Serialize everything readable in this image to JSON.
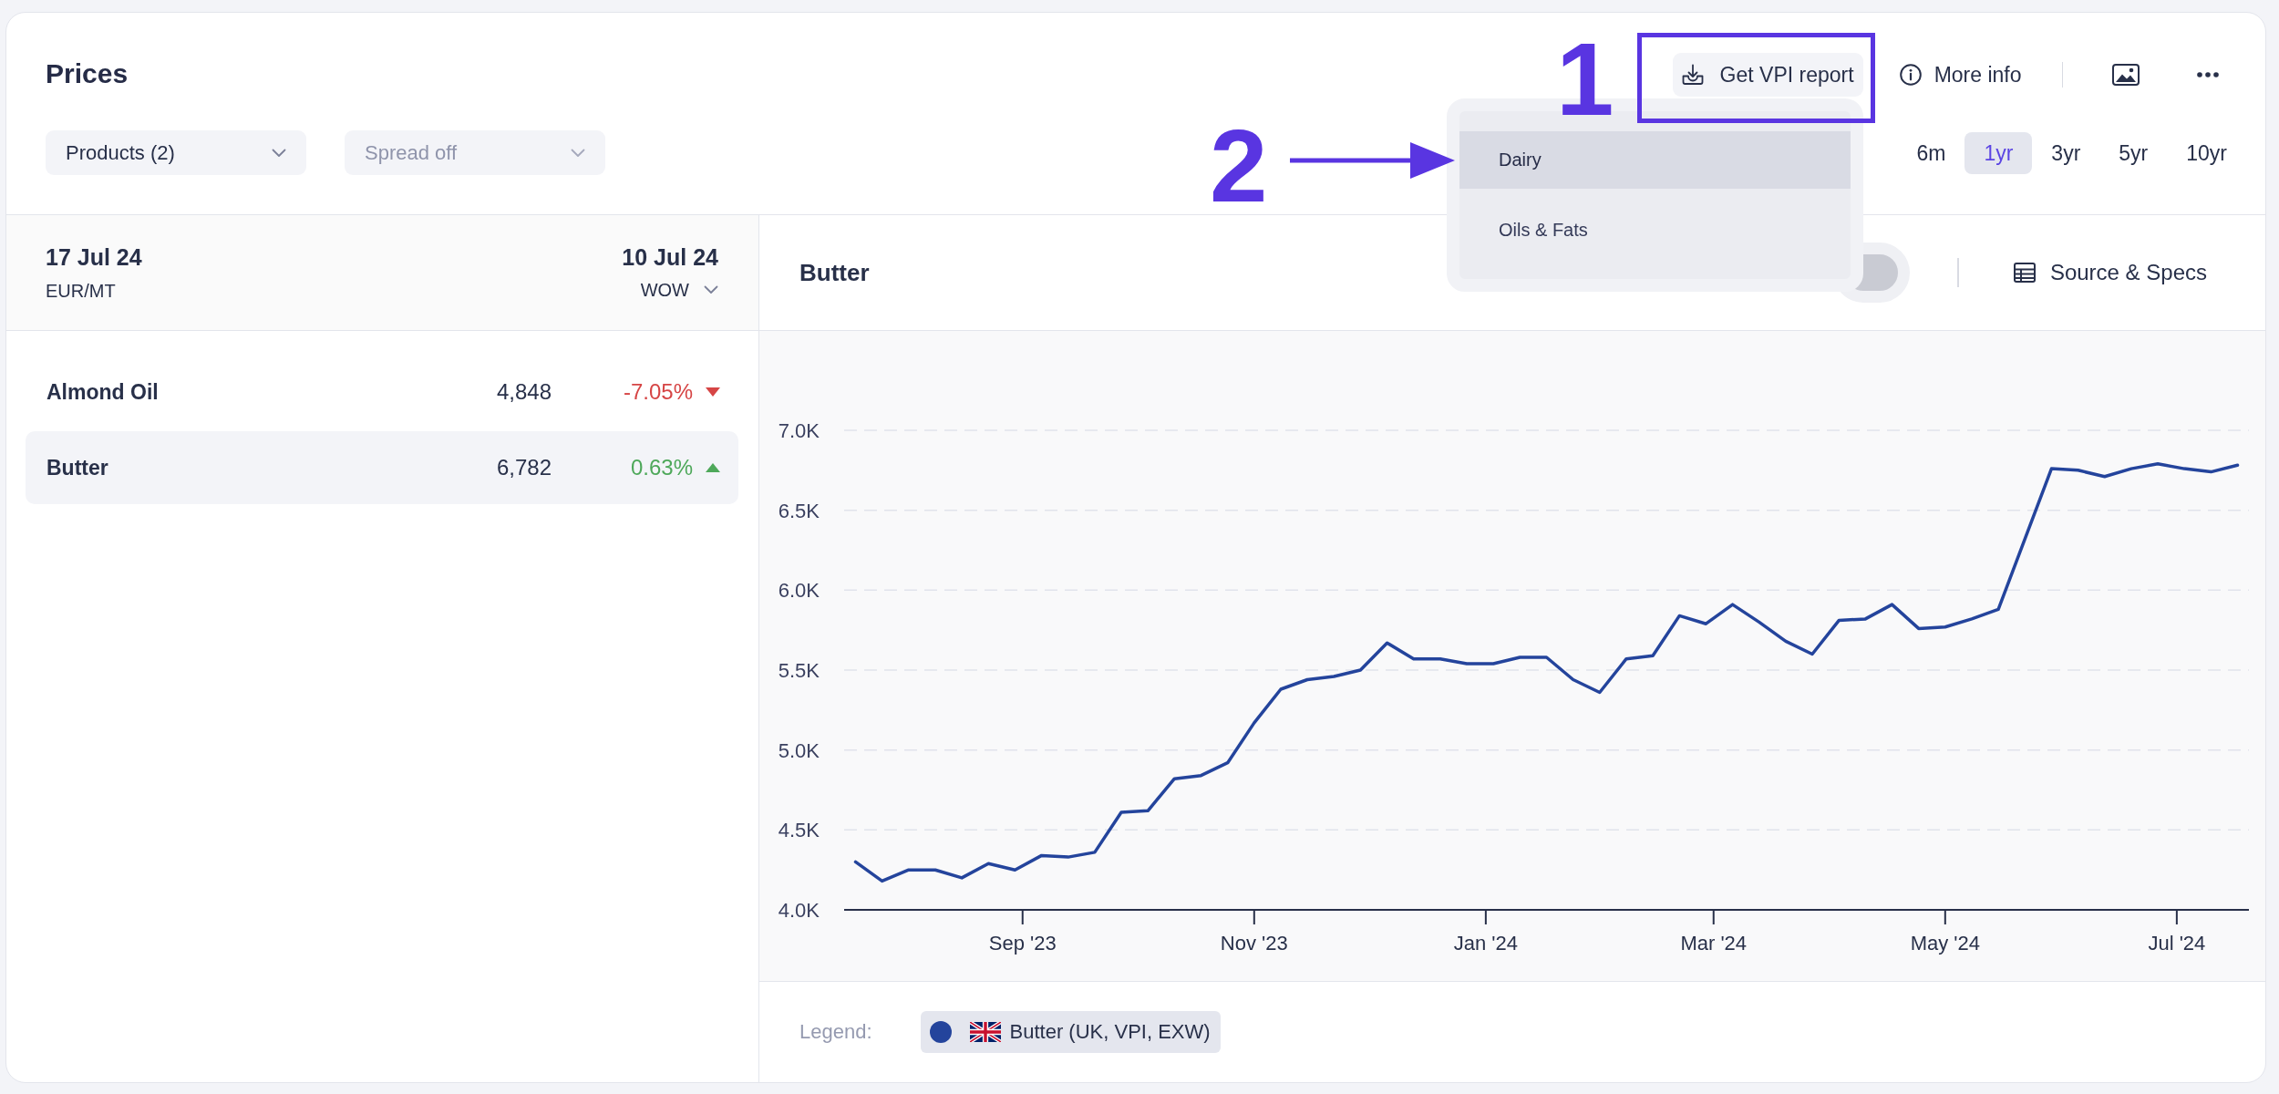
{
  "header": {
    "title": "Prices",
    "filters": [
      {
        "label": "Products (2)",
        "disabled": false
      },
      {
        "label": "Spread off",
        "disabled": true
      }
    ]
  },
  "actions": [
    {
      "kind": "report",
      "label": "Get VPI report"
    },
    {
      "kind": "info",
      "label": "More info"
    },
    {
      "kind": "image"
    },
    {
      "kind": "more"
    }
  ],
  "ranges": [
    {
      "label": "6m",
      "selected": false
    },
    {
      "label": "1yr",
      "selected": true
    },
    {
      "label": "3yr",
      "selected": false
    },
    {
      "label": "5yr",
      "selected": false
    },
    {
      "label": "10yr",
      "selected": false
    }
  ],
  "report_menu": {
    "items": [
      {
        "label": "Dairy",
        "highlighted": true
      },
      {
        "label": "Oils & Fats",
        "highlighted": false
      }
    ]
  },
  "annotations": [
    {
      "kind": "frame",
      "label": "1"
    },
    {
      "kind": "arrow",
      "label": "2"
    }
  ],
  "prices": {
    "date": "17 Jul 24",
    "unit": "EUR/MT",
    "compare_date": "10 Jul 24",
    "compare_mode": "WOW",
    "rows": [
      {
        "name": "Almond Oil",
        "price": "4,848",
        "change": "-7.05%",
        "rising": false,
        "selected": false
      },
      {
        "name": "Butter",
        "price": "6,782",
        "change": "0.63%",
        "rising": true,
        "selected": true
      }
    ]
  },
  "chart": {
    "title": "Butter",
    "toggle": {
      "on": false
    },
    "source_label": "Source & Specs",
    "legend_label": "Legend:",
    "chart_data": {
      "type": "line",
      "grid": true,
      "x": [
        "2023-07-19",
        "2023-07-26",
        "2023-08-02",
        "2023-08-09",
        "2023-08-16",
        "2023-08-23",
        "2023-08-30",
        "2023-09-06",
        "2023-09-13",
        "2023-09-20",
        "2023-09-27",
        "2023-10-04",
        "2023-10-11",
        "2023-10-18",
        "2023-10-25",
        "2023-11-01",
        "2023-11-08",
        "2023-11-15",
        "2023-11-22",
        "2023-11-29",
        "2023-12-06",
        "2023-12-13",
        "2023-12-20",
        "2023-12-27",
        "2024-01-03",
        "2024-01-10",
        "2024-01-17",
        "2024-01-24",
        "2024-01-31",
        "2024-02-07",
        "2024-02-14",
        "2024-02-21",
        "2024-02-28",
        "2024-03-06",
        "2024-03-13",
        "2024-03-20",
        "2024-03-27",
        "2024-04-03",
        "2024-04-10",
        "2024-04-17",
        "2024-04-24",
        "2024-05-01",
        "2024-05-08",
        "2024-05-15",
        "2024-05-22",
        "2024-05-29",
        "2024-06-05",
        "2024-06-12",
        "2024-06-19",
        "2024-06-26",
        "2024-07-03",
        "2024-07-10",
        "2024-07-17"
      ],
      "series": [
        {
          "name": "Butter (UK, VPI, EXW)",
          "color": "#24449c",
          "values": [
            4300,
            4180,
            4250,
            4250,
            4200,
            4290,
            4250,
            4340,
            4330,
            4360,
            4610,
            4620,
            4820,
            4840,
            4920,
            5170,
            5380,
            5440,
            5460,
            5500,
            5670,
            5570,
            5570,
            5540,
            5540,
            5580,
            5580,
            5440,
            5360,
            5570,
            5590,
            5840,
            5790,
            5910,
            5800,
            5680,
            5600,
            5810,
            5820,
            5910,
            5760,
            5770,
            5820,
            5880,
            6320,
            6760,
            6750,
            6710,
            6760,
            6790,
            6760,
            6740,
            6782
          ]
        }
      ],
      "xlim": [
        "2023-07-16",
        "2024-07-20"
      ],
      "ylim": [
        4000,
        7000
      ],
      "xticks": [
        {
          "value": "2023-09-01",
          "label": "Sep '23"
        },
        {
          "value": "2023-11-01",
          "label": "Nov '23"
        },
        {
          "value": "2024-01-01",
          "label": "Jan '24"
        },
        {
          "value": "2024-03-01",
          "label": "Mar '24"
        },
        {
          "value": "2024-05-01",
          "label": "May '24"
        },
        {
          "value": "2024-07-01",
          "label": "Jul '24"
        }
      ],
      "yticks": [
        {
          "value": 4000,
          "label": "4.0K"
        },
        {
          "value": 4500,
          "label": "4.5K"
        },
        {
          "value": 5000,
          "label": "5.0K"
        },
        {
          "value": 5500,
          "label": "5.5K"
        },
        {
          "value": 6000,
          "label": "6.0K"
        },
        {
          "value": 6500,
          "label": "6.5K"
        },
        {
          "value": 7000,
          "label": "7.0K"
        }
      ]
    }
  }
}
